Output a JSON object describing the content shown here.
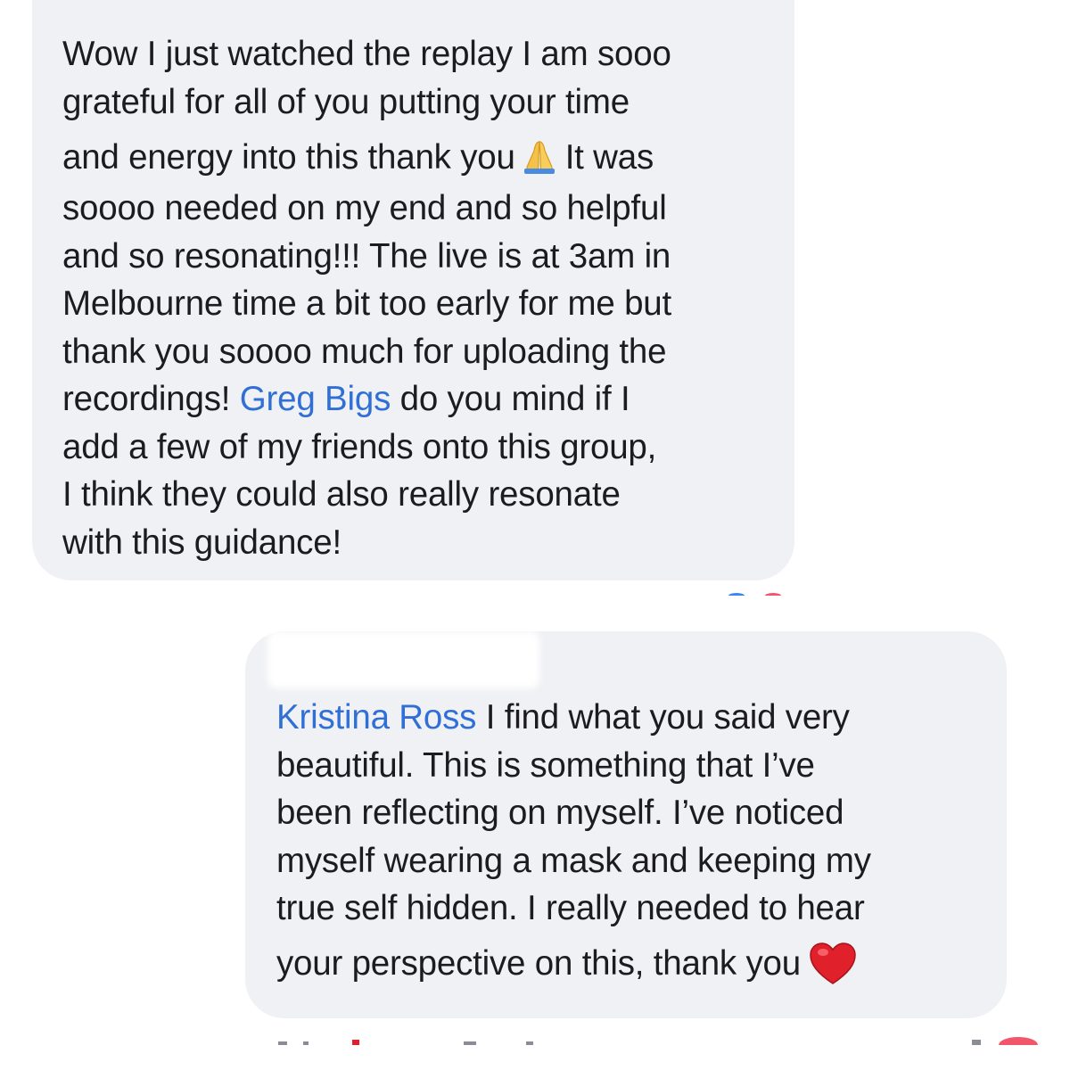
{
  "comments": [
    {
      "lines": [
        {
          "text": "Wow I just watched the replay I am sooo"
        },
        {
          "text": "grateful for all of you putting your time"
        },
        {
          "before": "and energy into this thank you",
          "after": "It was",
          "emoji": "folded-hands-icon"
        },
        {
          "text": "soooo needed on my end and so helpful"
        },
        {
          "text": "and so resonating!!! The live is at 3am in"
        },
        {
          "text": "Melbourne time a bit too early for me but"
        },
        {
          "text": "thank you soooo much for uploading the"
        },
        {
          "before": "recordings! ",
          "mention": "Greg Bigs",
          "after": " do you mind if I"
        },
        {
          "text": "add a few of my friends onto this group,"
        },
        {
          "text": "I think they could also really resonate"
        },
        {
          "text": "with this guidance!"
        }
      ]
    },
    {
      "lines": [
        {
          "mention": "Kristina Ross",
          "after": " I find what you said very"
        },
        {
          "text": "beautiful. This is something that I’ve"
        },
        {
          "text": "been reflecting on myself. I’ve noticed"
        },
        {
          "text": "myself wearing a mask and keeping my"
        },
        {
          "text": "true self hidden. I really needed to hear"
        },
        {
          "before": "your perspective on this, thank you",
          "emoji": "red-heart-icon"
        }
      ]
    }
  ],
  "colors": {
    "bubble": "#f0f1f4",
    "mention": "#2f6fd6",
    "text": "#1c1c1e",
    "heart": "#e0202a",
    "prayer": "#f2c24b"
  }
}
